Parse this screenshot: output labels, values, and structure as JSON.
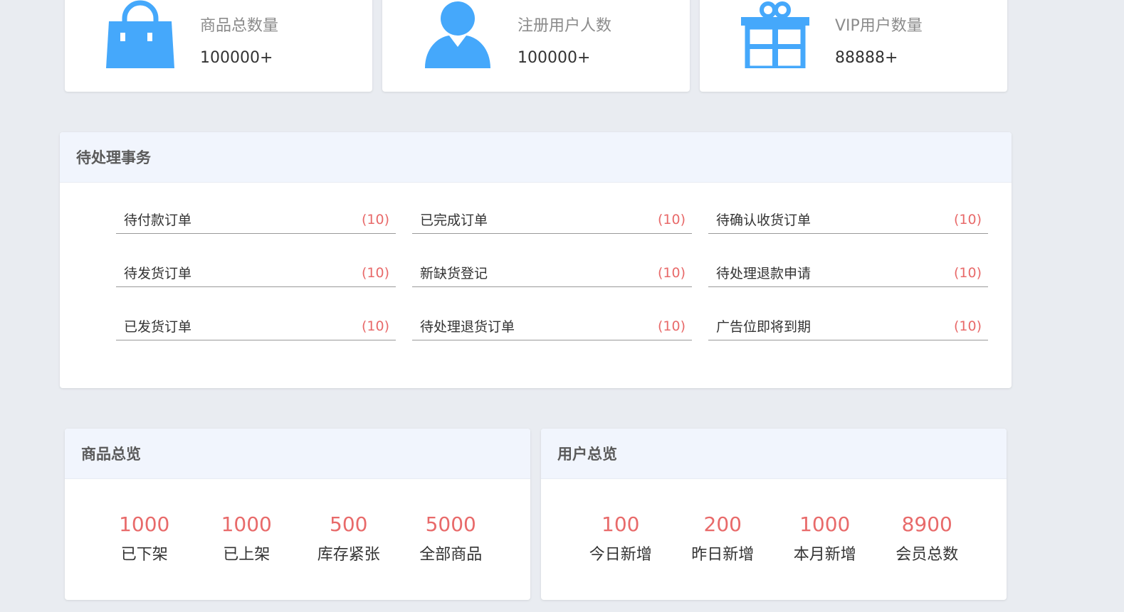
{
  "stats": [
    {
      "label": "商品总数量",
      "value": "100000+",
      "icon": "shopping-bag-icon"
    },
    {
      "label": "注册用户人数",
      "value": "100000+",
      "icon": "user-icon"
    },
    {
      "label": "VIP用户数量",
      "value": "88888+",
      "icon": "gift-icon"
    }
  ],
  "accent_color": "#45a8fb",
  "count_color": "#e86a6a",
  "pending": {
    "title": "待处理事务",
    "items": [
      {
        "name": "待付款订单",
        "count": "(10)"
      },
      {
        "name": "已完成订单",
        "count": "(10)"
      },
      {
        "name": "待确认收货订单",
        "count": "(10)"
      },
      {
        "name": "待发货订单",
        "count": "(10)"
      },
      {
        "name": "新缺货登记",
        "count": "(10)"
      },
      {
        "name": "待处理退款申请",
        "count": "(10)"
      },
      {
        "name": "已发货订单",
        "count": "(10)"
      },
      {
        "name": "待处理退货订单",
        "count": "(10)"
      },
      {
        "name": "广告位即将到期",
        "count": "(10)"
      }
    ]
  },
  "product_overview": {
    "title": "商品总览",
    "items": [
      {
        "value": "1000",
        "label": "已下架"
      },
      {
        "value": "1000",
        "label": "已上架"
      },
      {
        "value": "500",
        "label": "库存紧张"
      },
      {
        "value": "5000",
        "label": "全部商品"
      }
    ]
  },
  "user_overview": {
    "title": "用户总览",
    "items": [
      {
        "value": "100",
        "label": "今日新增"
      },
      {
        "value": "200",
        "label": "昨日新增"
      },
      {
        "value": "1000",
        "label": "本月新增"
      },
      {
        "value": "8900",
        "label": "会员总数"
      }
    ]
  }
}
